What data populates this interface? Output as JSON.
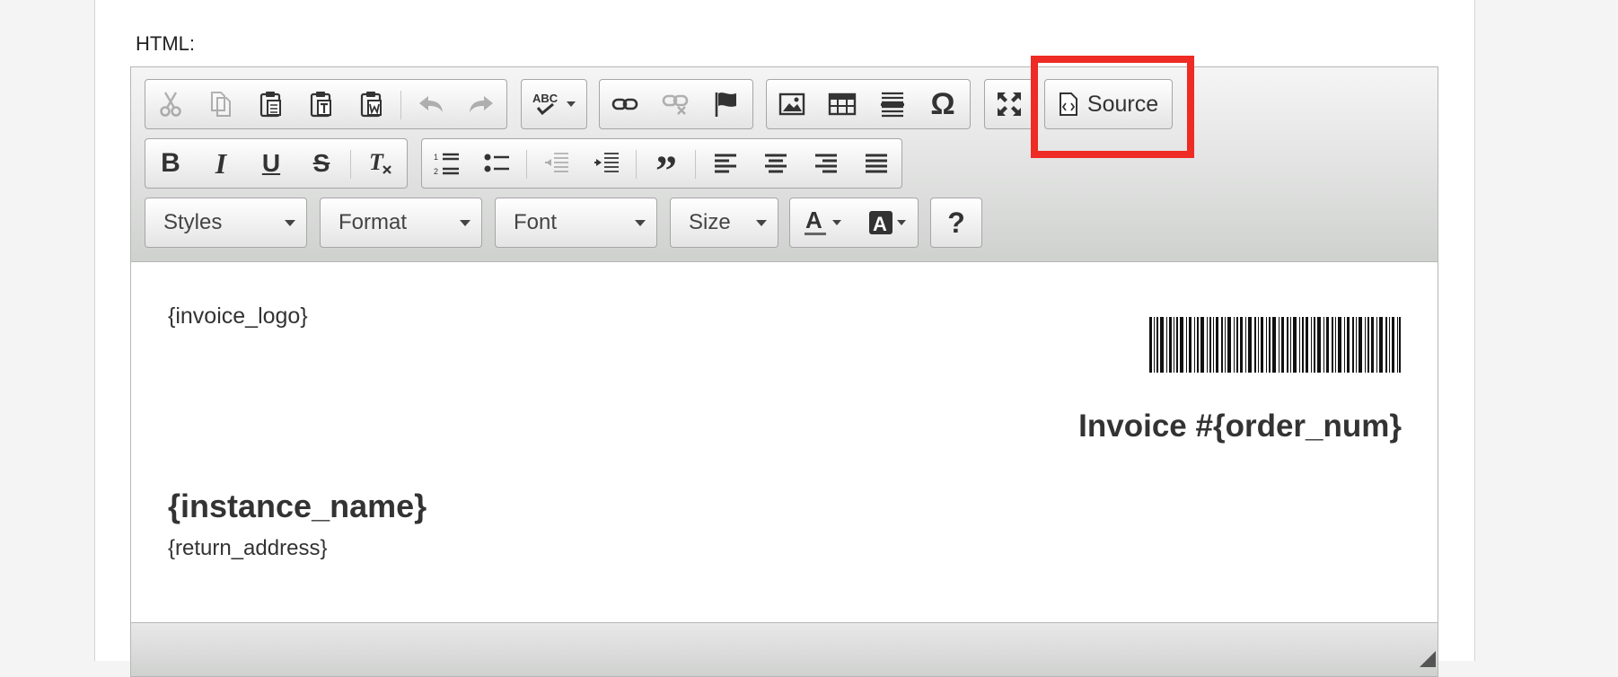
{
  "field": {
    "label": "HTML:"
  },
  "toolbar": {
    "row1": {
      "clipboard": [
        "cut-icon",
        "copy-icon",
        "paste-icon",
        "paste-text-icon",
        "paste-word-icon",
        "undo-icon",
        "redo-icon"
      ],
      "spellcheck": "spellcheck-icon",
      "links": [
        "link-icon",
        "unlink-icon",
        "anchor-icon"
      ],
      "insert": [
        "image-icon",
        "table-icon",
        "horizontal-line-icon",
        "special-char-icon"
      ],
      "maximize": "maximize-icon",
      "source_label": "Source"
    },
    "row2": {
      "basic": [
        "bold-icon",
        "italic-icon",
        "underline-icon",
        "strike-icon",
        "remove-format-icon"
      ],
      "paragraph": [
        "numbered-list-icon",
        "bulleted-list-icon",
        "outdent-icon",
        "indent-icon",
        "blockquote-icon",
        "align-left-icon",
        "align-center-icon",
        "align-right-icon",
        "justify-icon"
      ]
    },
    "row3": {
      "styles_label": "Styles",
      "format_label": "Format",
      "font_label": "Font",
      "size_label": "Size",
      "colors": [
        "text-color-icon",
        "background-color-icon"
      ],
      "help": "help-icon"
    }
  },
  "content": {
    "invoice_logo": "{invoice_logo}",
    "invoice_title": "Invoice #{order_num}",
    "instance_name": "{instance_name}",
    "return_address": "{return_address}"
  },
  "colors": {
    "highlight": "#ee2b24",
    "toolbar_top": "#f5f5f5",
    "toolbar_bottom": "#cfd1cf"
  }
}
